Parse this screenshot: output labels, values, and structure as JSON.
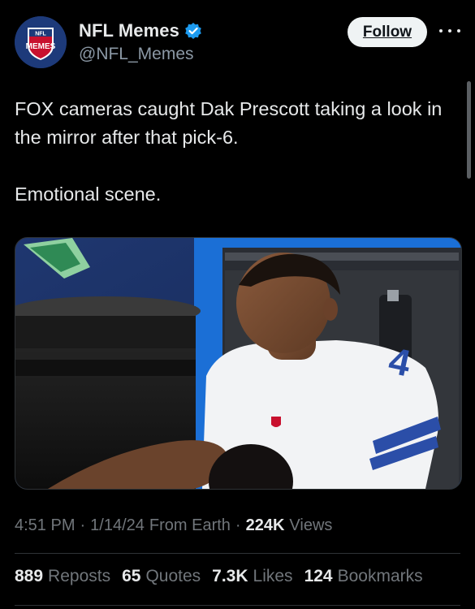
{
  "author": {
    "display_name": "NFL Memes",
    "handle": "@NFL_Memes",
    "verified": true,
    "avatar_text_top": "NFL",
    "avatar_text_main": "MEMES"
  },
  "actions": {
    "follow_label": "Follow",
    "more_icon": "more-horizontal-icon"
  },
  "tweet": {
    "paragraphs": [
      "FOX cameras caught Dak Prescott taking a look in the mirror after that pick-6.",
      "Emotional scene."
    ]
  },
  "media": {
    "type": "photo",
    "jersey_number": "4"
  },
  "meta": {
    "time": "4:51 PM",
    "date": "1/14/24",
    "source": "From Earth",
    "views_count": "224K",
    "views_label": "Views"
  },
  "stats": [
    {
      "count": "889",
      "label": "Reposts"
    },
    {
      "count": "65",
      "label": "Quotes"
    },
    {
      "count": "7.3K",
      "label": "Likes"
    },
    {
      "count": "124",
      "label": "Bookmarks"
    }
  ],
  "colors": {
    "background": "#000000",
    "text_primary": "#e7e9ea",
    "text_secondary": "#71767b",
    "verified_blue": "#1d9bf0",
    "follow_bg": "#eff3f4",
    "divider": "#2f3336"
  }
}
